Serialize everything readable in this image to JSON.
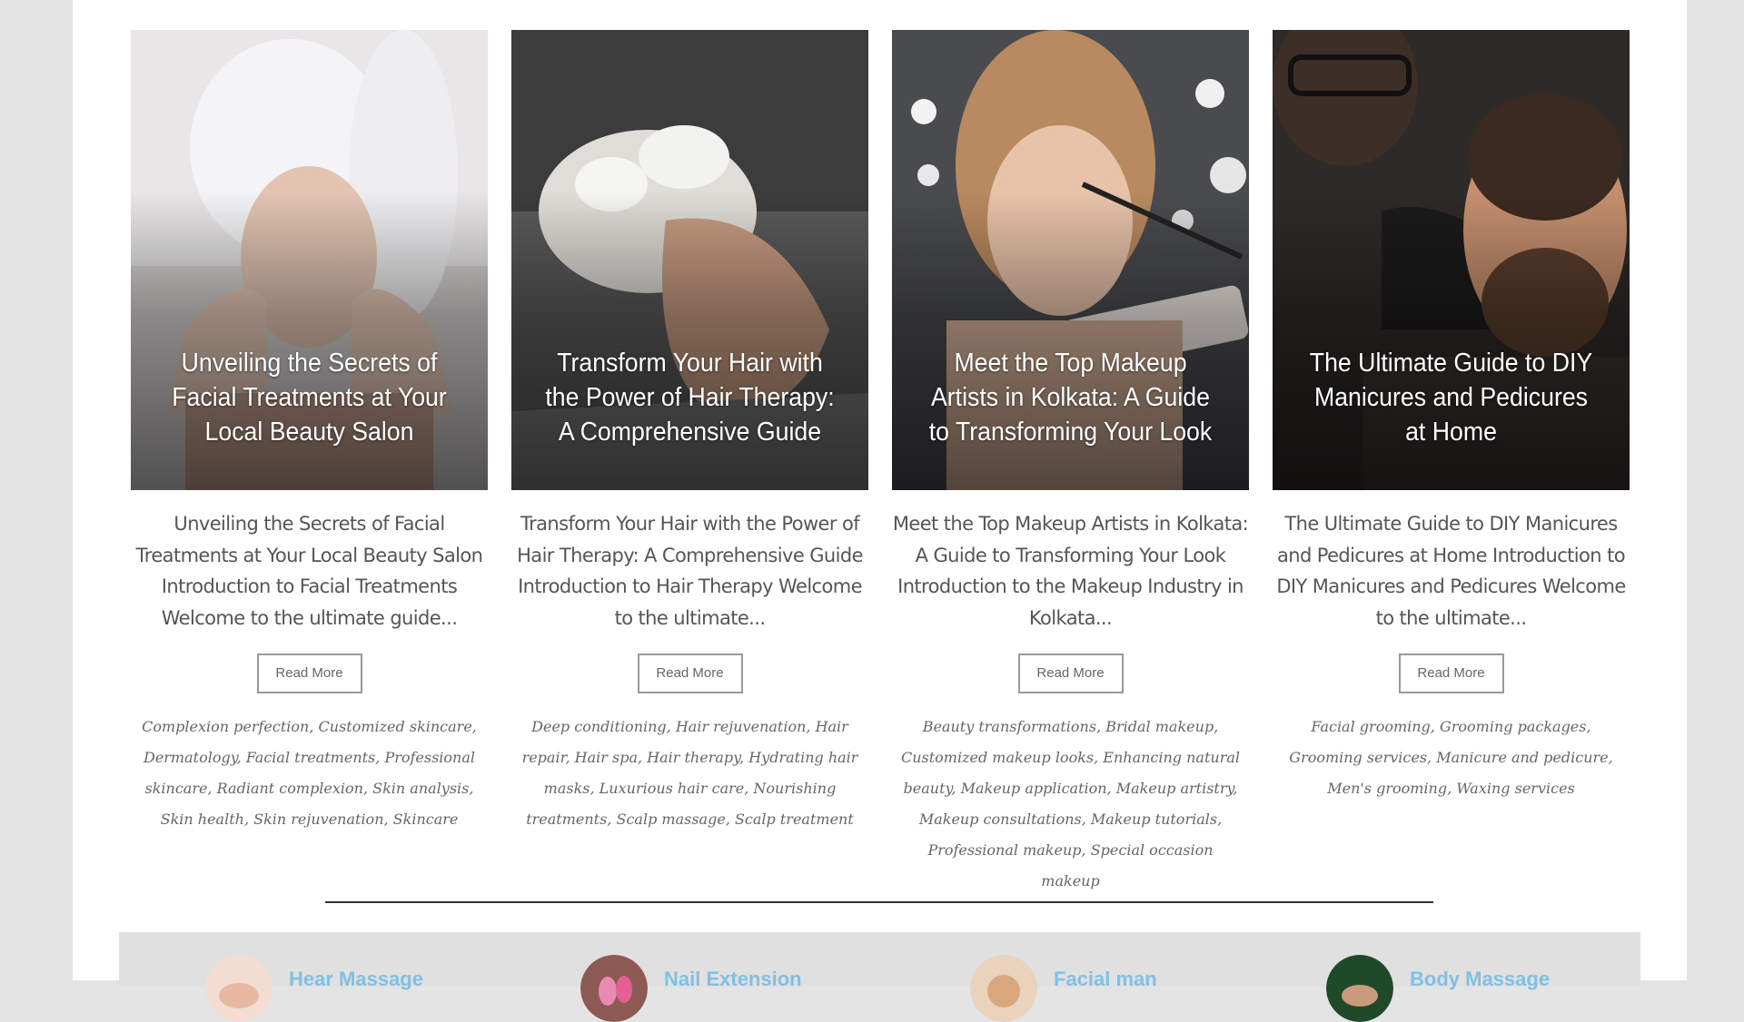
{
  "posts": [
    {
      "title": "Unveiling the Secrets of Facial Treatments at Your Local Beauty Salon",
      "excerpt": "Unveiling the Secrets of Facial Treatments at Your Local Beauty Salon Introduction to Facial Treatments Welcome to the ultimate guide...",
      "read_more": "Read More",
      "tags": [
        "Complexion perfection",
        "Customized skincare",
        "Dermatology",
        "Facial treatments",
        "Professional skincare",
        "Radiant complexion",
        "Skin analysis",
        "Skin health",
        "Skin rejuvenation",
        "Skincare"
      ]
    },
    {
      "title": "Transform Your Hair with the Power of Hair Therapy: A Comprehensive Guide",
      "excerpt": "Transform Your Hair with the Power of Hair Therapy: A Comprehensive Guide Introduction to Hair Therapy Welcome to the ultimate...",
      "read_more": "Read More",
      "tags": [
        "Deep conditioning",
        "Hair rejuvenation",
        "Hair repair",
        "Hair spa",
        "Hair therapy",
        "Hydrating hair masks",
        "Luxurious hair care",
        "Nourishing treatments",
        "Scalp massage",
        "Scalp treatment"
      ]
    },
    {
      "title": "Meet the Top Makeup Artists in Kolkata: A Guide to Transforming Your Look",
      "excerpt": "Meet the Top Makeup Artists in Kolkata: A Guide to Transforming Your Look Introduction to the Makeup Industry in Kolkata...",
      "read_more": "Read More",
      "tags": [
        "Beauty transformations",
        "Bridal makeup",
        "Customized makeup looks",
        "Enhancing natural beauty",
        "Makeup application",
        "Makeup artistry",
        "Makeup consultations",
        "Makeup tutorials",
        "Professional makeup",
        "Special occasion makeup"
      ]
    },
    {
      "title": "The Ultimate Guide to DIY Manicures and Pedicures at Home",
      "excerpt": "The Ultimate Guide to DIY Manicures and Pedicures at Home Introduction to DIY Manicures and Pedicures Welcome to the ultimate...",
      "read_more": "Read More",
      "tags": [
        "Facial grooming",
        "Grooming packages",
        "Grooming services",
        "Manicure and pedicure",
        "Men's grooming",
        "Waxing services"
      ]
    }
  ],
  "services": [
    {
      "label": "Hear Massage"
    },
    {
      "label": "Nail Extension"
    },
    {
      "label": "Facial man"
    },
    {
      "label": "Body Massage"
    }
  ],
  "colors": {
    "service_link": "#7fc0e6",
    "page_bg": "#e4e4e4",
    "card_text": "#555555"
  }
}
